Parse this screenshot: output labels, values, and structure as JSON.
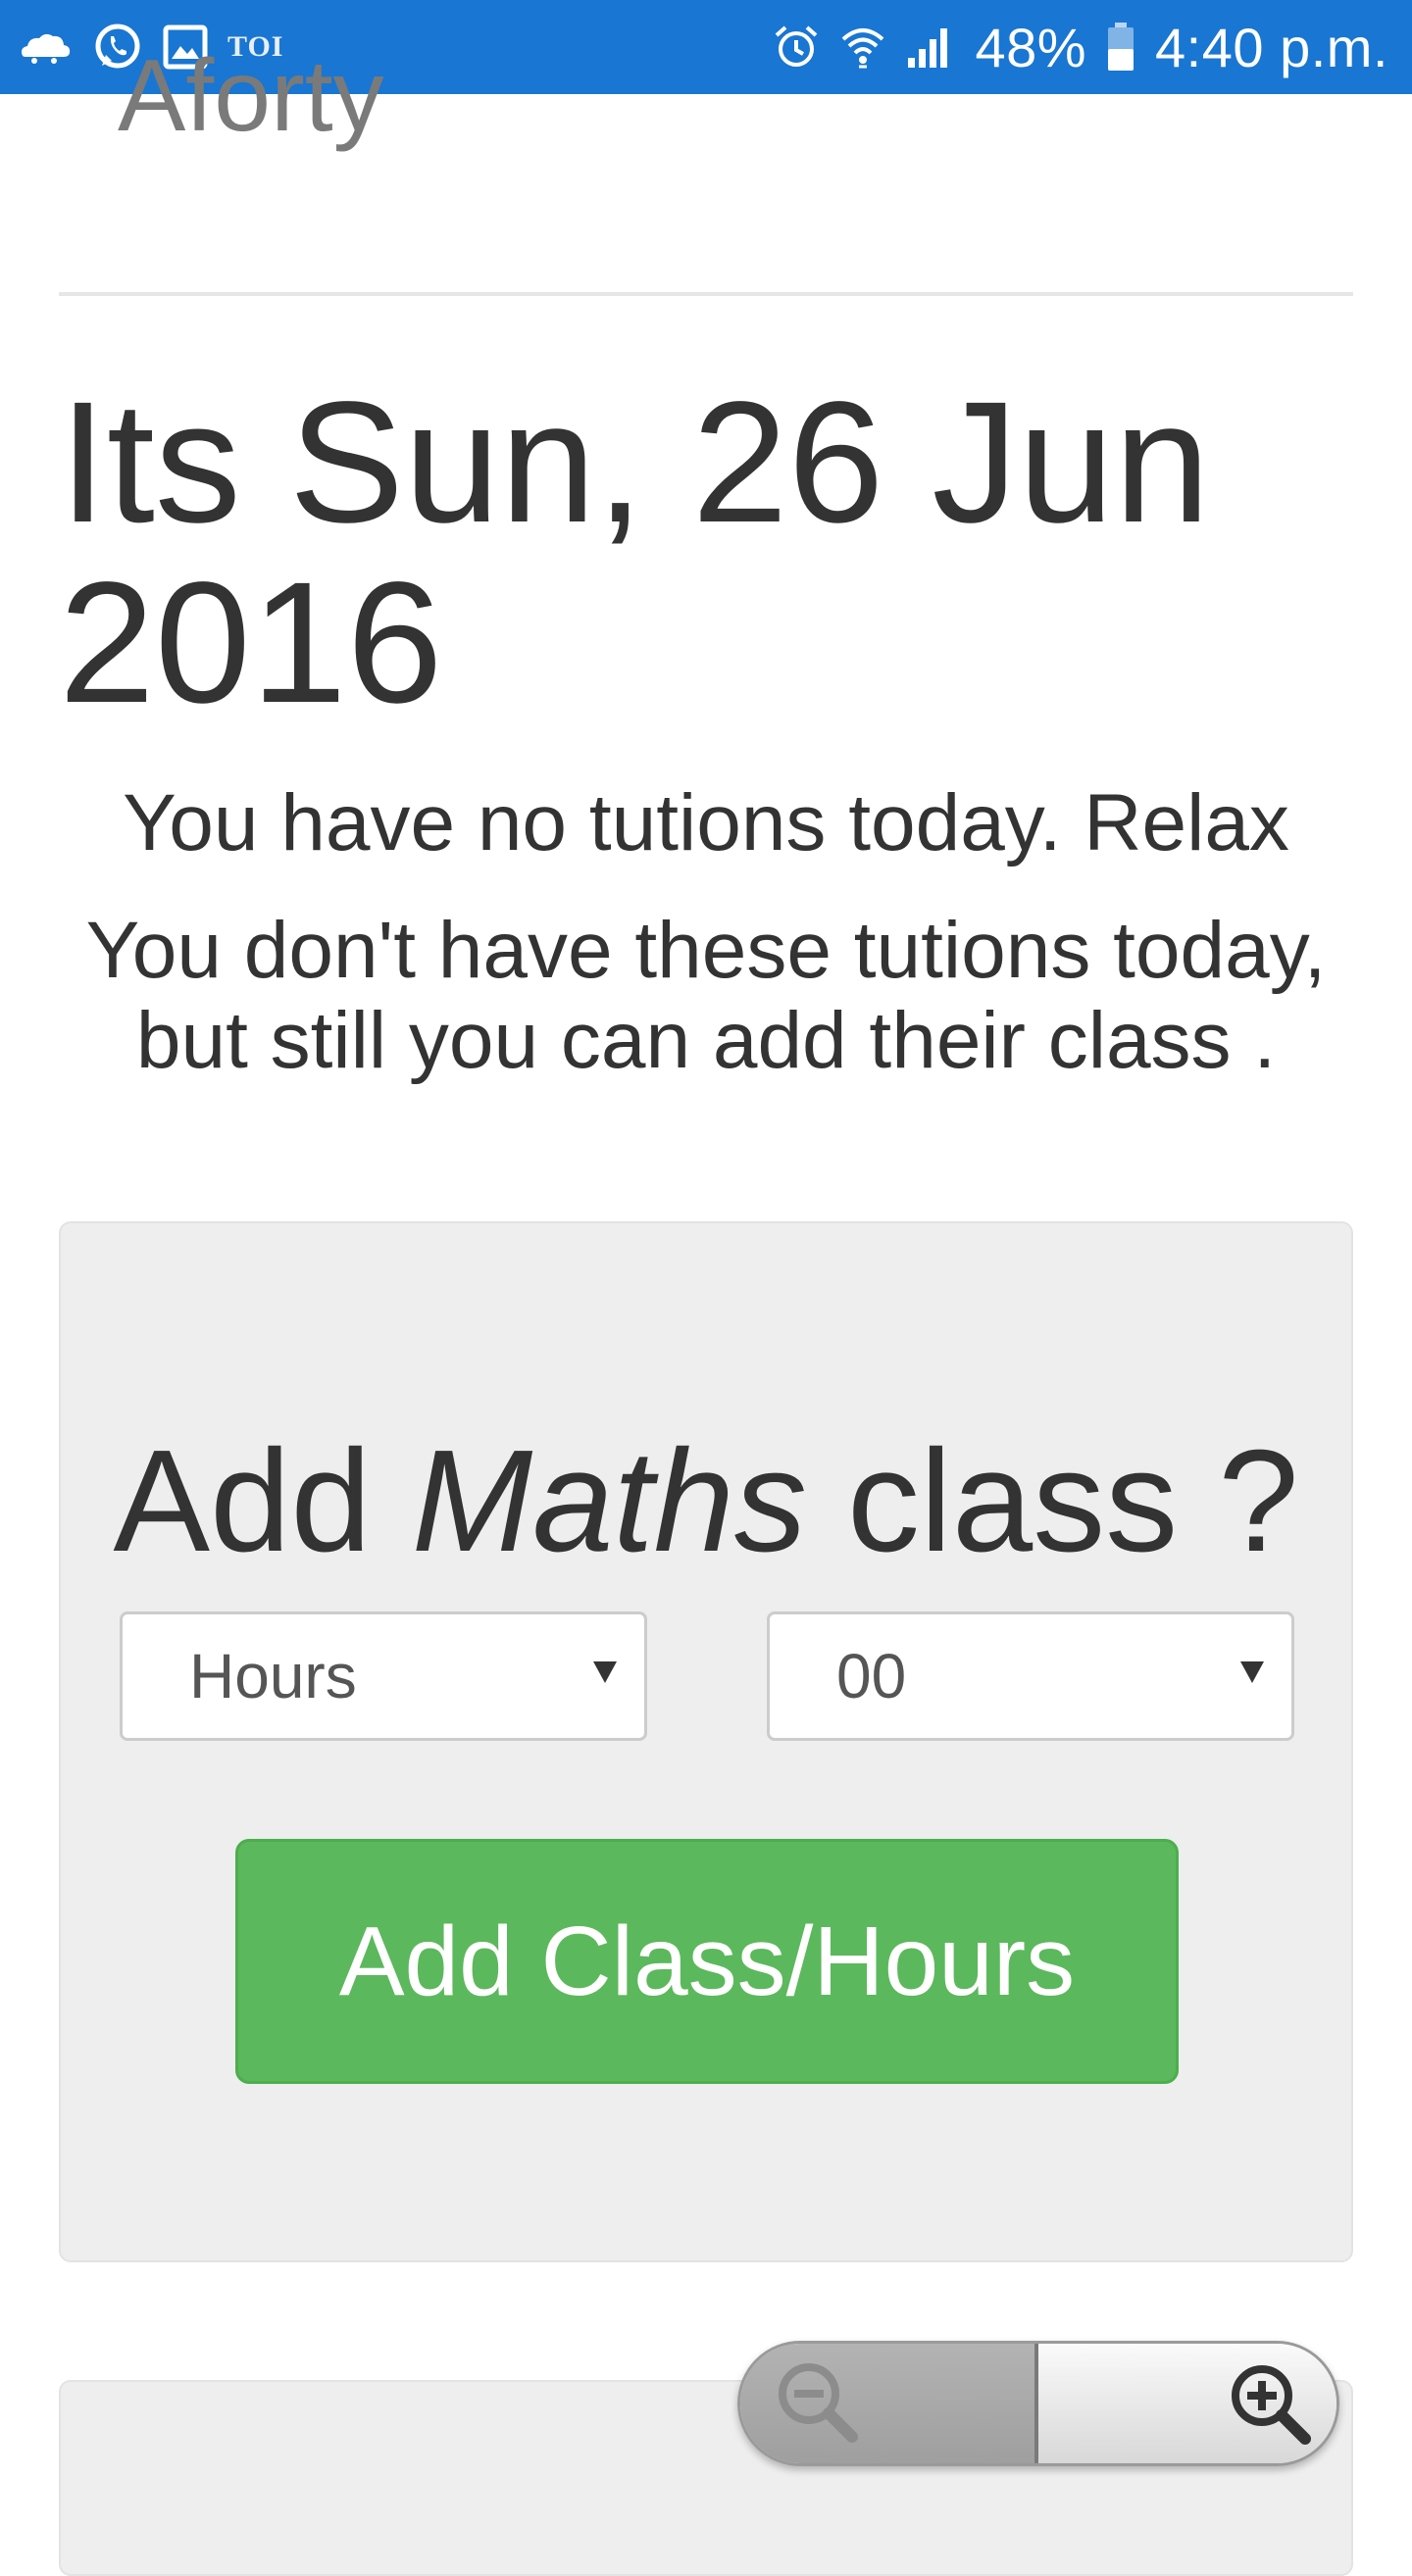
{
  "status_bar": {
    "left_icons": [
      "cloud-icon",
      "whatsapp-icon",
      "gallery-icon"
    ],
    "toi_label": "TOI",
    "right_icons": [
      "alarm-icon",
      "wifi-icon",
      "signal-icon",
      "battery-icon"
    ],
    "battery": "48%",
    "time": "4:40 p.m.",
    "color": "#1976d2"
  },
  "brand": {
    "name": "Aforty"
  },
  "main": {
    "date_heading": "Its Sun, 26 Jun 2016",
    "no_tutions_message": "You have no tutions today. Relax",
    "suggestion_message": "You don't have these tutions today, but still you can add their class ."
  },
  "add_class_panel": {
    "heading_prefix": "Add ",
    "subject": "Maths",
    "heading_suffix": " class ?",
    "hours_select": {
      "selected": "Hours"
    },
    "minutes_select": {
      "selected": "00"
    },
    "add_button_label": "Add Class/Hours",
    "button_color": "#5cb85c"
  },
  "zoom_control": {
    "icons": [
      "zoom-out-icon",
      "zoom-in-icon"
    ]
  }
}
